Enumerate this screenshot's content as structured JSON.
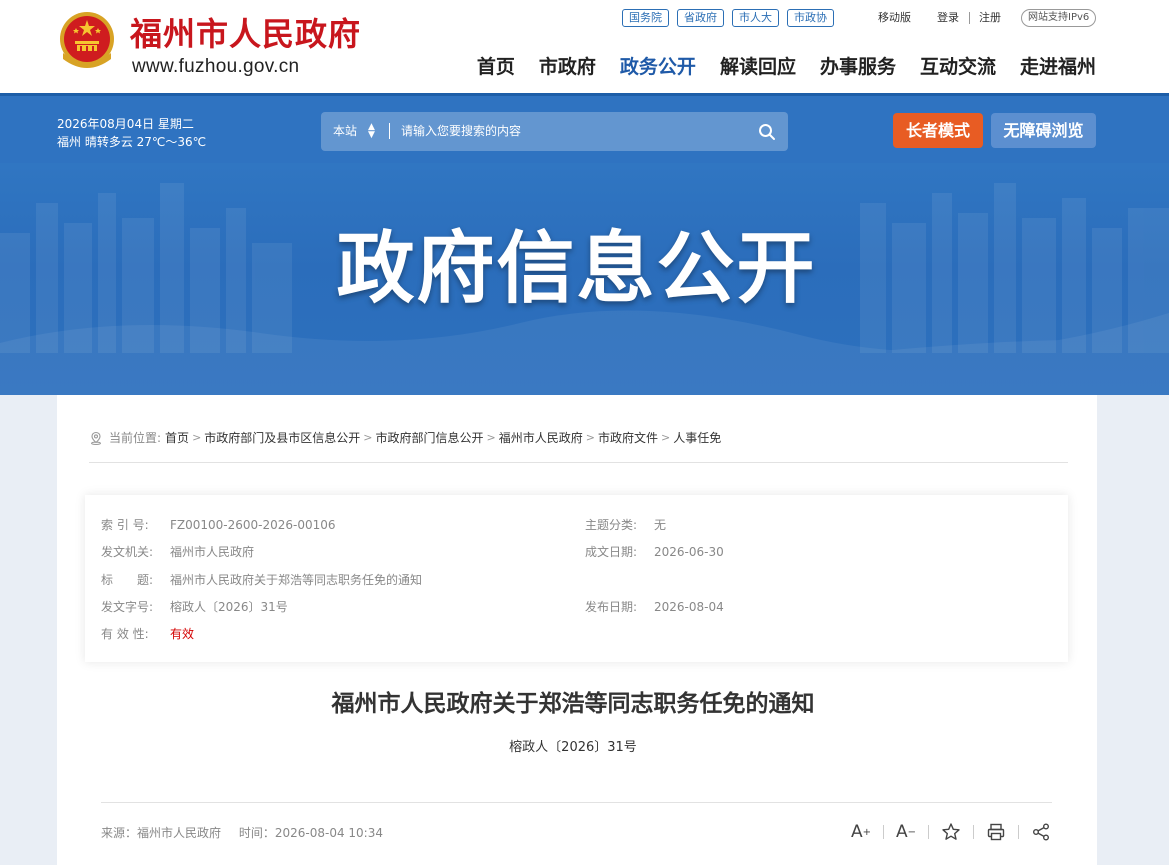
{
  "header": {
    "site_name": "福州市人民政府",
    "site_url": "www.fuzhou.gov.cn",
    "top_links": [
      "国务院",
      "省政府",
      "市人大",
      "市政协"
    ],
    "mobile_label": "移动版",
    "login_label": "登录",
    "register_label": "注册",
    "ipv6_label": "网站支持IPv6",
    "nav": [
      "首页",
      "市政府",
      "政务公开",
      "解读回应",
      "办事服务",
      "互动交流",
      "走进福州"
    ],
    "active_nav": "政务公开"
  },
  "topbar": {
    "date": "2026年08月04日 星期二",
    "weather": "福州 晴转多云 27℃～36℃",
    "search_scope": "本站",
    "search_placeholder": "请输入您要搜索的内容",
    "elder_mode_label": "长者模式",
    "accessibility_label": "无障碍浏览"
  },
  "banner": {
    "title": "政府信息公开"
  },
  "breadcrumb": {
    "label": "当前位置:",
    "items": [
      "首页",
      "市政府部门及县市区信息公开",
      "市政府部门信息公开",
      "福州市人民政府",
      "市政府文件",
      "人事任免"
    ]
  },
  "meta": {
    "index_label": "索 引 号:",
    "index_value": "FZ00100-2600-2026-00106",
    "topic_label": "主题分类:",
    "topic_value": "无",
    "issuer_label": "发文机关:",
    "issuer_value": "福州市人民政府",
    "created_label": "成文日期:",
    "created_value": "2026-06-30",
    "title_label": "标　　题:",
    "title_value": "福州市人民政府关于郑浩等同志职务任免的通知",
    "docno_label": "发文字号:",
    "docno_value": "榕政人〔2026〕31号",
    "published_label": "发布日期:",
    "published_value": "2026-08-04",
    "validity_label": "有 效 性:",
    "validity_value": "有效",
    "validity_color": "#d40000"
  },
  "document": {
    "title": "福州市人民政府关于郑浩等同志职务任免的通知",
    "number": "榕政人〔2026〕31号",
    "source": "来源：福州市人民政府",
    "time": "时间：2026-08-04 10:34"
  },
  "tools": {
    "font_larger": "A",
    "font_larger_sup": "+",
    "font_smaller": "A",
    "font_smaller_sup": "−",
    "icons": [
      "font-larger-icon",
      "font-smaller-icon",
      "star-icon",
      "print-icon",
      "share-icon"
    ]
  },
  "colors": {
    "brand_red": "#c8161d",
    "nav_active": "#1f5aa8",
    "topbar_blue": "#2f73c1",
    "elder_orange": "#e85c23",
    "access_blue": "#5c8fd0"
  }
}
